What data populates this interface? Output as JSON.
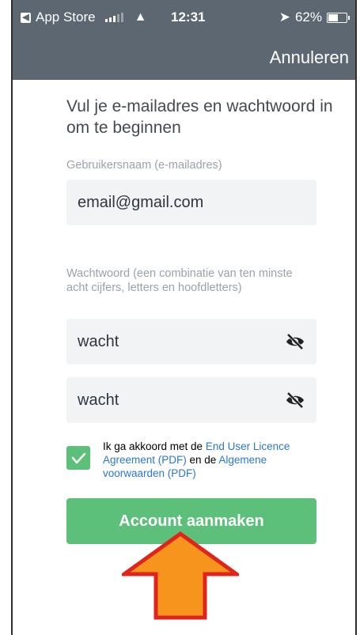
{
  "status_bar": {
    "back_app": "App Store",
    "time": "12:31",
    "battery": "62%",
    "battery_level": 0.62
  },
  "header": {
    "cancel_label": "Annuleren"
  },
  "intro_text": "Vul je e-mailadres en wachtwoord in om te beginnen",
  "username": {
    "label": "Gebruikersnaam (e-mailadres)",
    "value": "email@gmail.com"
  },
  "password": {
    "label": "Wachtwoord (een combinatie van ten minste acht cijfers, letters en hoofdletters)",
    "value": "wacht",
    "confirm_value": "wacht"
  },
  "agreement": {
    "checked": true,
    "text_before": "Ik ga akkoord met de ",
    "eula_link": "End User Licence Agreement (PDF)",
    "text_middle": " en de ",
    "terms_link": "Algemene voorwaarden (PDF)"
  },
  "create_button_label": "Account aanmaken",
  "colors": {
    "header": "#5c6771",
    "primary_green": "#5cc07a",
    "link_blue": "#2a78d0",
    "annotation_arrow_fill": "#f7941d",
    "annotation_arrow_stroke": "#e0241b"
  }
}
